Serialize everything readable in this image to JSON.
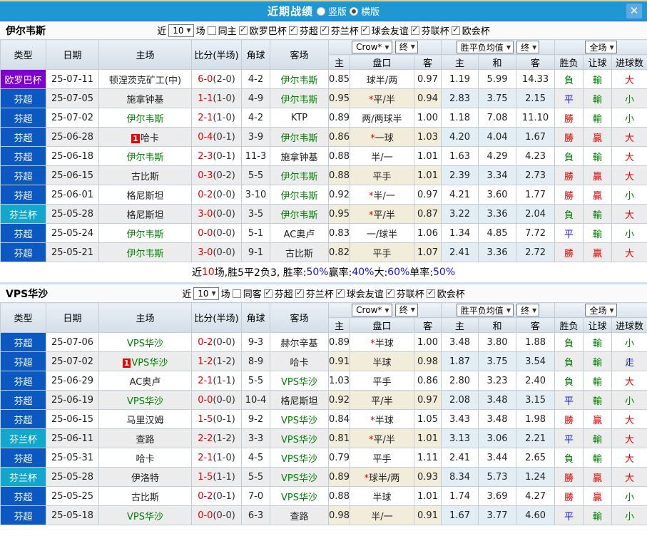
{
  "colors": {
    "titlebar_bg": "#1f97d3",
    "titlebar_top_strip": "#d9d3a3",
    "close_btn_bg": "#5fa9e3",
    "header_bg": "#dae3ec",
    "stripe": "#ececec",
    "odds_col_bg": "#fbf4e4",
    "avg_col_bg": "#ecf5fb",
    "score_red": "#e80000",
    "team_green": "#008000",
    "league_colors": {
      "欧罗巴杯": "#7e00d0",
      "芬超": "#0b58c2",
      "芬兰杯": "#13a7cd"
    },
    "result_colors": {
      "勝": "#e60000",
      "贏": "#e60000",
      "大": "#e60000",
      "負": "#008000",
      "輸": "#008000",
      "小": "#008000",
      "平": "#1212e0",
      "走": "#1212e0"
    }
  },
  "titlebar": {
    "title": "近期战绩",
    "radios": [
      {
        "label": "竖版",
        "checked": false
      },
      {
        "label": "横版",
        "checked": true
      }
    ],
    "close_label": "✕"
  },
  "table_header": {
    "static_cols": [
      "类型",
      "日期",
      "主场",
      "比分(半场)",
      "角球",
      "客场"
    ],
    "odds_group": {
      "bookmaker": "Crow*",
      "state": "终"
    },
    "odds_cols": [
      "主",
      "盘口",
      "客"
    ],
    "avg_group": {
      "label": "胜平负均值",
      "state": "终"
    },
    "avg_cols": [
      "主",
      "和",
      "客"
    ],
    "scope_group": {
      "label": "全场"
    },
    "result_cols": [
      "胜负",
      "让球",
      "进球数"
    ]
  },
  "sections": [
    {
      "team": "伊尔韦斯",
      "filters": {
        "prefix": "近",
        "count": "10",
        "suffix": "场",
        "same": {
          "label": "同主",
          "checked": false
        },
        "leagues": [
          {
            "label": "欧罗巴杯",
            "checked": true
          },
          {
            "label": "芬超",
            "checked": true
          },
          {
            "label": "芬兰杯",
            "checked": true
          },
          {
            "label": "球会友谊",
            "checked": true
          },
          {
            "label": "芬联杯",
            "checked": true
          },
          {
            "label": "欧会杯",
            "checked": true
          }
        ]
      },
      "rows": [
        {
          "league": "欧罗巴杯",
          "date": "25-07-11",
          "home": {
            "name": "顿涅茨克矿工(中)",
            "self": false,
            "badge": ""
          },
          "score": "6-0",
          "half": "(2-0)",
          "corners": "4-2",
          "away": {
            "name": "伊尔韦斯",
            "self": true,
            "badge": ""
          },
          "odds_home": "0.85",
          "handicap": {
            "star": false,
            "text": "球半/两"
          },
          "odds_away": "0.97",
          "avg": [
            "1.19",
            "5.99",
            "14.33"
          ],
          "results": [
            "負",
            "輸",
            "大"
          ]
        },
        {
          "league": "芬超",
          "date": "25-07-05",
          "home": {
            "name": "施拿钟基",
            "self": false,
            "badge": ""
          },
          "score": "1-1",
          "half": "(1-0)",
          "corners": "4-9",
          "away": {
            "name": "伊尔韦斯",
            "self": true,
            "badge": ""
          },
          "odds_home": "0.95",
          "handicap": {
            "star": true,
            "text": "平/半"
          },
          "odds_away": "0.94",
          "avg": [
            "2.83",
            "3.75",
            "2.15"
          ],
          "results": [
            "平",
            "輸",
            "小"
          ]
        },
        {
          "league": "芬超",
          "date": "25-07-02",
          "home": {
            "name": "伊尔韦斯",
            "self": true,
            "badge": ""
          },
          "score": "2-1",
          "half": "(1-0)",
          "corners": "4-2",
          "away": {
            "name": "KTP",
            "self": false,
            "badge": ""
          },
          "odds_home": "0.89",
          "handicap": {
            "star": false,
            "text": "两/两球半"
          },
          "odds_away": "1.00",
          "avg": [
            "1.18",
            "7.08",
            "11.10"
          ],
          "results": [
            "勝",
            "輸",
            "小"
          ]
        },
        {
          "league": "芬超",
          "date": "25-06-28",
          "home": {
            "name": "哈卡",
            "self": false,
            "badge": "1"
          },
          "score": "0-4",
          "half": "(0-1)",
          "corners": "3-9",
          "away": {
            "name": "伊尔韦斯",
            "self": true,
            "badge": ""
          },
          "odds_home": "0.86",
          "handicap": {
            "star": true,
            "text": "一球"
          },
          "odds_away": "1.03",
          "avg": [
            "4.20",
            "4.04",
            "1.67"
          ],
          "results": [
            "勝",
            "贏",
            "大"
          ]
        },
        {
          "league": "芬超",
          "date": "25-06-18",
          "home": {
            "name": "伊尔韦斯",
            "self": true,
            "badge": ""
          },
          "score": "2-3",
          "half": "(0-1)",
          "corners": "11-3",
          "away": {
            "name": "施拿钟基",
            "self": false,
            "badge": ""
          },
          "odds_home": "0.88",
          "handicap": {
            "star": false,
            "text": "半/一"
          },
          "odds_away": "1.01",
          "avg": [
            "1.63",
            "4.29",
            "4.23"
          ],
          "results": [
            "負",
            "輸",
            "大"
          ]
        },
        {
          "league": "芬超",
          "date": "25-06-15",
          "home": {
            "name": "古比斯",
            "self": false,
            "badge": ""
          },
          "score": "0-3",
          "half": "(0-2)",
          "corners": "5-5",
          "away": {
            "name": "伊尔韦斯",
            "self": true,
            "badge": ""
          },
          "odds_home": "0.88",
          "handicap": {
            "star": false,
            "text": "平手"
          },
          "odds_away": "1.01",
          "avg": [
            "2.39",
            "3.34",
            "2.73"
          ],
          "results": [
            "勝",
            "贏",
            "大"
          ]
        },
        {
          "league": "芬超",
          "date": "25-06-01",
          "home": {
            "name": "格尼斯坦",
            "self": false,
            "badge": ""
          },
          "score": "0-2",
          "half": "(0-0)",
          "corners": "3-10",
          "away": {
            "name": "伊尔韦斯",
            "self": true,
            "badge": ""
          },
          "odds_home": "0.92",
          "handicap": {
            "star": true,
            "text": "半/一"
          },
          "odds_away": "0.97",
          "avg": [
            "4.21",
            "3.60",
            "1.77"
          ],
          "results": [
            "勝",
            "贏",
            "小"
          ]
        },
        {
          "league": "芬兰杯",
          "date": "25-05-28",
          "home": {
            "name": "格尼斯坦",
            "self": false,
            "badge": ""
          },
          "score": "3-0",
          "half": "(0-0)",
          "corners": "3-5",
          "away": {
            "name": "伊尔韦斯",
            "self": true,
            "badge": ""
          },
          "odds_home": "0.95",
          "handicap": {
            "star": true,
            "text": "平/半"
          },
          "odds_away": "0.87",
          "avg": [
            "3.22",
            "3.36",
            "2.04"
          ],
          "results": [
            "負",
            "輸",
            "大"
          ]
        },
        {
          "league": "芬超",
          "date": "25-05-24",
          "home": {
            "name": "伊尔韦斯",
            "self": true,
            "badge": ""
          },
          "score": "0-0",
          "half": "(0-0)",
          "corners": "5-1",
          "away": {
            "name": "AC奥卢",
            "self": false,
            "badge": ""
          },
          "odds_home": "0.83",
          "handicap": {
            "star": false,
            "text": "一/球半"
          },
          "odds_away": "1.06",
          "avg": [
            "1.34",
            "4.85",
            "7.72"
          ],
          "results": [
            "平",
            "輸",
            "小"
          ]
        },
        {
          "league": "芬超",
          "date": "25-05-21",
          "home": {
            "name": "伊尔韦斯",
            "self": true,
            "badge": ""
          },
          "score": "3-0",
          "half": "(0-0)",
          "corners": "9-1",
          "away": {
            "name": "古比斯",
            "self": false,
            "badge": ""
          },
          "odds_home": "0.82",
          "handicap": {
            "star": false,
            "text": "平手"
          },
          "odds_away": "1.07",
          "avg": [
            "2.41",
            "3.36",
            "2.72"
          ],
          "results": [
            "勝",
            "贏",
            "大"
          ]
        }
      ],
      "summary": [
        {
          "t": "近"
        },
        {
          "t": "10",
          "c": "#e80000"
        },
        {
          "t": "场,胜5平2负3, 胜率:"
        },
        {
          "t": "50%",
          "c": "#1212e0"
        },
        {
          "t": " 赢率:"
        },
        {
          "t": "40%",
          "c": "#1212e0"
        },
        {
          "t": " 大:"
        },
        {
          "t": "60%",
          "c": "#1212e0"
        },
        {
          "t": " 单率:"
        },
        {
          "t": "50%",
          "c": "#1212e0"
        }
      ]
    },
    {
      "team": "VPS华沙",
      "filters": {
        "prefix": "近",
        "count": "10",
        "suffix": "场",
        "same": {
          "label": "同客",
          "checked": false
        },
        "leagues": [
          {
            "label": "芬超",
            "checked": true
          },
          {
            "label": "芬兰杯",
            "checked": true
          },
          {
            "label": "球会友谊",
            "checked": true
          },
          {
            "label": "芬联杯",
            "checked": true
          },
          {
            "label": "欧会杯",
            "checked": true
          }
        ]
      },
      "rows": [
        {
          "league": "芬超",
          "date": "25-07-06",
          "home": {
            "name": "VPS华沙",
            "self": true,
            "badge": ""
          },
          "score": "0-2",
          "half": "(0-0)",
          "corners": "9-3",
          "away": {
            "name": "赫尔辛基",
            "self": false,
            "badge": ""
          },
          "odds_home": "0.89",
          "handicap": {
            "star": true,
            "text": "半球"
          },
          "odds_away": "1.00",
          "avg": [
            "3.48",
            "3.80",
            "1.88"
          ],
          "results": [
            "負",
            "輸",
            "小"
          ]
        },
        {
          "league": "芬超",
          "date": "25-07-02",
          "home": {
            "name": "VPS华沙",
            "self": true,
            "badge": "1"
          },
          "score": "1-2",
          "half": "(1-2)",
          "corners": "8-9",
          "away": {
            "name": "哈卡",
            "self": false,
            "badge": ""
          },
          "odds_home": "0.91",
          "handicap": {
            "star": false,
            "text": "半球"
          },
          "odds_away": "0.98",
          "avg": [
            "1.87",
            "3.75",
            "3.54"
          ],
          "results": [
            "負",
            "輸",
            "走"
          ]
        },
        {
          "league": "芬超",
          "date": "25-06-29",
          "home": {
            "name": "AC奥卢",
            "self": false,
            "badge": ""
          },
          "score": "2-1",
          "half": "(1-1)",
          "corners": "5-5",
          "away": {
            "name": "VPS华沙",
            "self": true,
            "badge": ""
          },
          "odds_home": "1.03",
          "handicap": {
            "star": false,
            "text": "平手"
          },
          "odds_away": "0.86",
          "avg": [
            "2.80",
            "3.23",
            "2.40"
          ],
          "results": [
            "負",
            "輸",
            "大"
          ]
        },
        {
          "league": "芬超",
          "date": "25-06-19",
          "home": {
            "name": "VPS华沙",
            "self": true,
            "badge": ""
          },
          "score": "0-0",
          "half": "(0-0)",
          "corners": "10-4",
          "away": {
            "name": "格尼斯坦",
            "self": false,
            "badge": ""
          },
          "odds_home": "0.92",
          "handicap": {
            "star": false,
            "text": "平/半"
          },
          "odds_away": "0.97",
          "avg": [
            "2.08",
            "3.48",
            "3.15"
          ],
          "results": [
            "平",
            "輸",
            "小"
          ]
        },
        {
          "league": "芬超",
          "date": "25-06-15",
          "home": {
            "name": "马里汉姆",
            "self": false,
            "badge": ""
          },
          "score": "1-5",
          "half": "(0-1)",
          "corners": "9-2",
          "away": {
            "name": "VPS华沙",
            "self": true,
            "badge": ""
          },
          "odds_home": "0.84",
          "handicap": {
            "star": true,
            "text": "半球"
          },
          "odds_away": "1.05",
          "avg": [
            "3.43",
            "3.48",
            "1.98"
          ],
          "results": [
            "勝",
            "贏",
            "大"
          ]
        },
        {
          "league": "芬兰杯",
          "date": "25-06-11",
          "home": {
            "name": "查路",
            "self": false,
            "badge": ""
          },
          "score": "2-2",
          "half": "(1-2)",
          "corners": "3-3",
          "away": {
            "name": "VPS华沙",
            "self": true,
            "badge": ""
          },
          "odds_home": "0.81",
          "handicap": {
            "star": true,
            "text": "平/半"
          },
          "odds_away": "1.01",
          "avg": [
            "3.13",
            "3.06",
            "2.21"
          ],
          "results": [
            "平",
            "輸",
            "大"
          ]
        },
        {
          "league": "芬超",
          "date": "25-05-31",
          "home": {
            "name": "哈卡",
            "self": false,
            "badge": ""
          },
          "score": "2-1",
          "half": "(1-0)",
          "corners": "4-5",
          "away": {
            "name": "VPS华沙",
            "self": true,
            "badge": ""
          },
          "odds_home": "0.79",
          "handicap": {
            "star": false,
            "text": "平手"
          },
          "odds_away": "1.11",
          "avg": [
            "2.41",
            "3.44",
            "2.65"
          ],
          "results": [
            "負",
            "輸",
            "大"
          ]
        },
        {
          "league": "芬兰杯",
          "date": "25-05-28",
          "home": {
            "name": "伊洛特",
            "self": false,
            "badge": ""
          },
          "score": "1-5",
          "half": "(1-1)",
          "corners": "5-5",
          "away": {
            "name": "VPS华沙",
            "self": true,
            "badge": ""
          },
          "odds_home": "0.89",
          "handicap": {
            "star": true,
            "text": "球半/两"
          },
          "odds_away": "0.93",
          "avg": [
            "8.34",
            "5.73",
            "1.24"
          ],
          "results": [
            "勝",
            "贏",
            "大"
          ]
        },
        {
          "league": "芬超",
          "date": "25-05-25",
          "home": {
            "name": "古比斯",
            "self": false,
            "badge": ""
          },
          "score": "0-2",
          "half": "(0-1)",
          "corners": "7-0",
          "away": {
            "name": "VPS华沙",
            "self": true,
            "badge": ""
          },
          "odds_home": "0.88",
          "handicap": {
            "star": false,
            "text": "半球"
          },
          "odds_away": "1.01",
          "avg": [
            "1.74",
            "3.69",
            "4.27"
          ],
          "results": [
            "勝",
            "贏",
            "小"
          ]
        },
        {
          "league": "芬超",
          "date": "25-05-18",
          "home": {
            "name": "VPS华沙",
            "self": true,
            "badge": ""
          },
          "score": "0-0",
          "half": "(0-0)",
          "corners": "6-3",
          "away": {
            "name": "查路",
            "self": false,
            "badge": ""
          },
          "odds_home": "0.98",
          "handicap": {
            "star": false,
            "text": "半/一"
          },
          "odds_away": "0.91",
          "avg": [
            "1.67",
            "3.77",
            "4.60"
          ],
          "results": [
            "平",
            "輸",
            "小"
          ]
        }
      ],
      "summary": null
    }
  ]
}
